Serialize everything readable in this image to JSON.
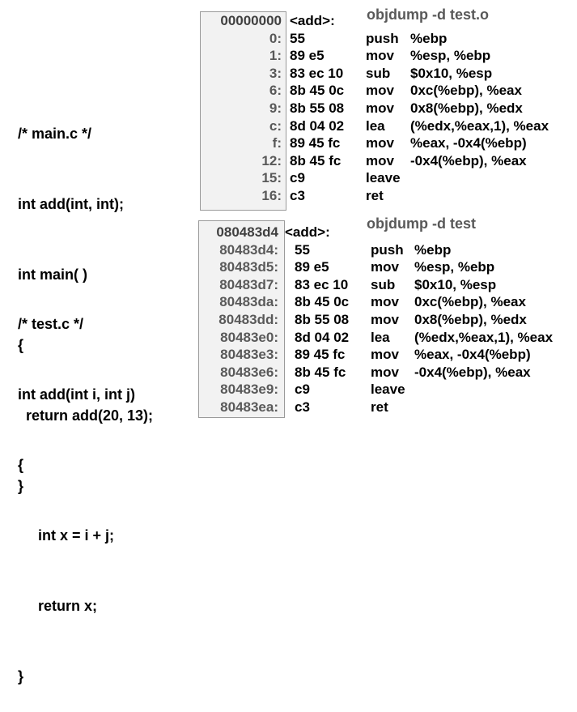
{
  "main_c": {
    "lines": [
      "/* main.c */",
      "int add(int, int);",
      "int main( )",
      "{",
      "  return add(20, 13);",
      "}"
    ]
  },
  "test_c": {
    "lines": [
      "/* test.c */",
      "int add(int i, int j)",
      "{",
      "     int x = i + j;",
      "     return x;",
      "}"
    ]
  },
  "obj_dump": {
    "title": "objdump -d test.o",
    "header_addr": "00000000",
    "header_label": "<add>:",
    "rows": [
      {
        "addr": "0:",
        "bytes": "55",
        "mnemonic": "push",
        "operands": "%ebp"
      },
      {
        "addr": "1:",
        "bytes": "89 e5",
        "mnemonic": "mov",
        "operands": "%esp, %ebp"
      },
      {
        "addr": "3:",
        "bytes": "83 ec 10",
        "mnemonic": "sub",
        "operands": "$0x10, %esp"
      },
      {
        "addr": "6:",
        "bytes": "8b 45 0c",
        "mnemonic": "mov",
        "operands": "0xc(%ebp), %eax"
      },
      {
        "addr": "9:",
        "bytes": "8b 55 08",
        "mnemonic": "mov",
        "operands": "0x8(%ebp), %edx"
      },
      {
        "addr": "c:",
        "bytes": "8d 04 02",
        "mnemonic": "lea",
        "operands": "(%edx,%eax,1), %eax"
      },
      {
        "addr": "f:",
        "bytes": "89 45 fc",
        "mnemonic": "mov",
        "operands": "%eax, -0x4(%ebp)"
      },
      {
        "addr": "12:",
        "bytes": "8b 45 fc",
        "mnemonic": "mov",
        "operands": "-0x4(%ebp), %eax"
      },
      {
        "addr": "15:",
        "bytes": "c9",
        "mnemonic": "leave",
        "operands": ""
      },
      {
        "addr": "16:",
        "bytes": "c3",
        "mnemonic": "ret",
        "operands": ""
      }
    ]
  },
  "exe_dump": {
    "title": "objdump -d test",
    "header_addr": "080483d4",
    "header_label": "<add>:",
    "rows": [
      {
        "addr": "80483d4:",
        "bytes": "55",
        "mnemonic": "push",
        "operands": "%ebp"
      },
      {
        "addr": "80483d5:",
        "bytes": "89 e5",
        "mnemonic": "mov",
        "operands": "%esp, %ebp"
      },
      {
        "addr": "80483d7:",
        "bytes": "83 ec 10",
        "mnemonic": "sub",
        "operands": "$0x10, %esp"
      },
      {
        "addr": "80483da:",
        "bytes": "8b 45 0c",
        "mnemonic": "mov",
        "operands": "0xc(%ebp), %eax"
      },
      {
        "addr": "80483dd:",
        "bytes": "8b 55 08",
        "mnemonic": "mov",
        "operands": "0x8(%ebp), %edx"
      },
      {
        "addr": "80483e0:",
        "bytes": "8d 04 02",
        "mnemonic": "lea",
        "operands": "(%edx,%eax,1), %eax"
      },
      {
        "addr": "80483e3:",
        "bytes": "89 45 fc",
        "mnemonic": "mov",
        "operands": "%eax, -0x4(%ebp)"
      },
      {
        "addr": "80483e6:",
        "bytes": "8b 45 fc",
        "mnemonic": "mov",
        "operands": "-0x4(%ebp), %eax"
      },
      {
        "addr": "80483e9:",
        "bytes": "c9",
        "mnemonic": "leave",
        "operands": ""
      },
      {
        "addr": "80483ea:",
        "bytes": "c3",
        "mnemonic": "ret",
        "operands": ""
      }
    ]
  }
}
